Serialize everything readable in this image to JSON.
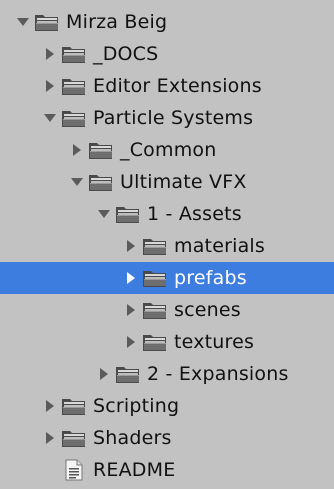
{
  "colors": {
    "background": "#c2c2c2",
    "selection": "#3d7de0",
    "selected_text": "#ffffff",
    "text": "#111111",
    "arrow": "#5b5b5b"
  },
  "tree": {
    "items": [
      {
        "label": "Mirza Beig",
        "depth": 0,
        "expanded": true,
        "type": "folder",
        "icon": "folder-icon"
      },
      {
        "label": "_DOCS",
        "depth": 1,
        "expanded": false,
        "type": "folder",
        "icon": "folder-icon"
      },
      {
        "label": "Editor Extensions",
        "depth": 1,
        "expanded": false,
        "type": "folder",
        "icon": "folder-icon"
      },
      {
        "label": "Particle Systems",
        "depth": 1,
        "expanded": true,
        "type": "folder",
        "icon": "folder-icon"
      },
      {
        "label": "_Common",
        "depth": 2,
        "expanded": false,
        "type": "folder",
        "icon": "folder-icon"
      },
      {
        "label": "Ultimate VFX",
        "depth": 2,
        "expanded": true,
        "type": "folder",
        "icon": "folder-icon"
      },
      {
        "label": "1 - Assets",
        "depth": 3,
        "expanded": true,
        "type": "folder",
        "icon": "folder-icon"
      },
      {
        "label": "materials",
        "depth": 4,
        "expanded": false,
        "type": "folder",
        "icon": "folder-icon"
      },
      {
        "label": "prefabs",
        "depth": 4,
        "expanded": false,
        "type": "folder",
        "icon": "folder-icon",
        "selected": true
      },
      {
        "label": "scenes",
        "depth": 4,
        "expanded": false,
        "type": "folder",
        "icon": "folder-icon"
      },
      {
        "label": "textures",
        "depth": 4,
        "expanded": false,
        "type": "folder",
        "icon": "folder-icon"
      },
      {
        "label": "2 - Expansions",
        "depth": 3,
        "expanded": false,
        "type": "folder",
        "icon": "folder-icon"
      },
      {
        "label": "Scripting",
        "depth": 1,
        "expanded": false,
        "type": "folder",
        "icon": "folder-icon"
      },
      {
        "label": "Shaders",
        "depth": 1,
        "expanded": false,
        "type": "folder",
        "icon": "folder-icon"
      },
      {
        "label": "README",
        "depth": 1,
        "type": "file",
        "icon": "text-file-icon"
      }
    ]
  }
}
